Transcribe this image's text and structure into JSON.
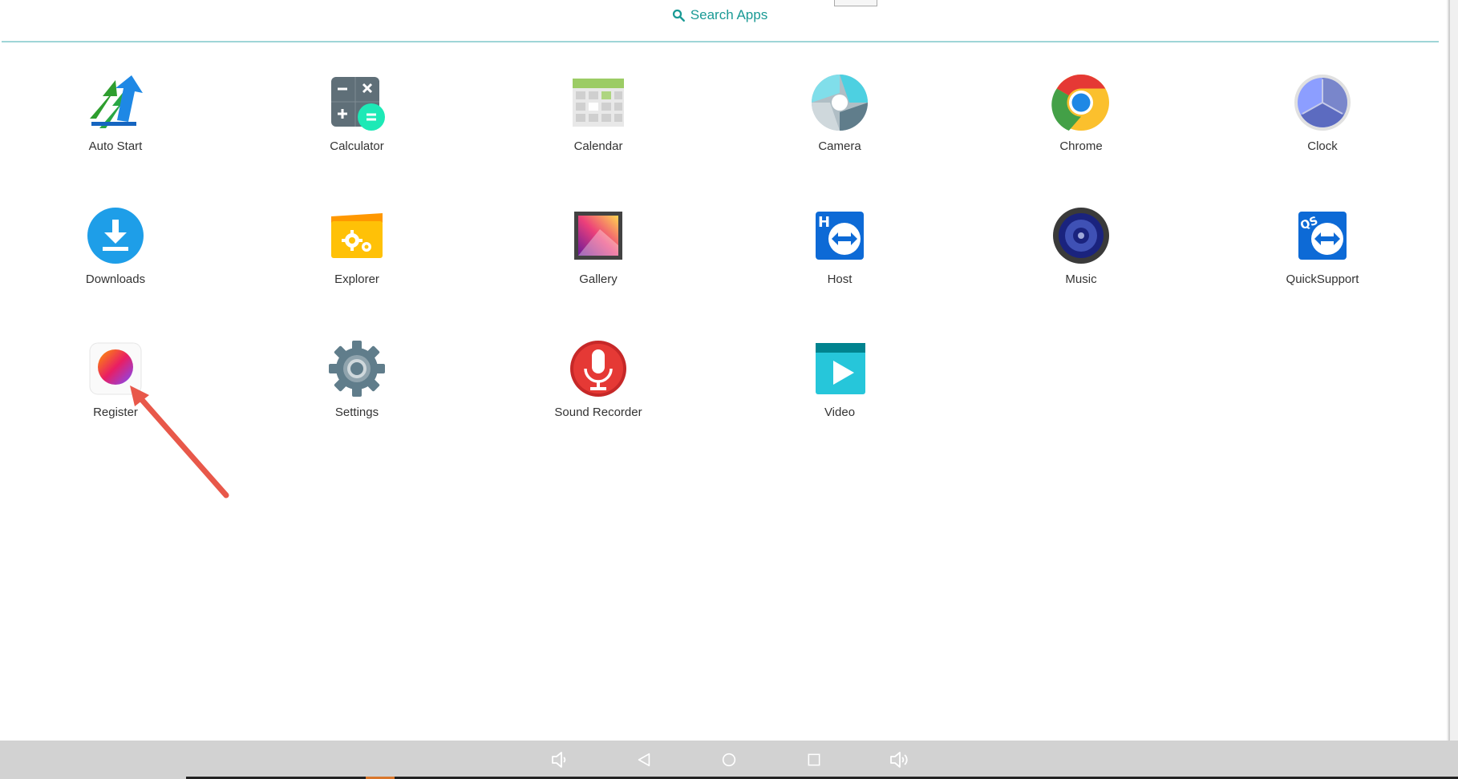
{
  "search": {
    "label": "Search Apps"
  },
  "apps": [
    {
      "name": "auto-start",
      "label": "Auto Start",
      "icon": "auto-start-icon"
    },
    {
      "name": "calculator",
      "label": "Calculator",
      "icon": "calculator-icon"
    },
    {
      "name": "calendar",
      "label": "Calendar",
      "icon": "calendar-icon"
    },
    {
      "name": "camera",
      "label": "Camera",
      "icon": "camera-icon"
    },
    {
      "name": "chrome",
      "label": "Chrome",
      "icon": "chrome-icon"
    },
    {
      "name": "clock",
      "label": "Clock",
      "icon": "clock-icon"
    },
    {
      "name": "downloads",
      "label": "Downloads",
      "icon": "download-icon"
    },
    {
      "name": "explorer",
      "label": "Explorer",
      "icon": "folder-gear-icon"
    },
    {
      "name": "gallery",
      "label": "Gallery",
      "icon": "gallery-icon"
    },
    {
      "name": "host",
      "label": "Host",
      "icon": "teamviewer-host-icon"
    },
    {
      "name": "music",
      "label": "Music",
      "icon": "speaker-icon"
    },
    {
      "name": "quicksupport",
      "label": "QuickSupport",
      "icon": "teamviewer-quicksupport-icon"
    },
    {
      "name": "register",
      "label": "Register",
      "icon": "gradient-orb-icon"
    },
    {
      "name": "settings",
      "label": "Settings",
      "icon": "gear-icon"
    },
    {
      "name": "sound-recorder",
      "label": "Sound Recorder",
      "icon": "microphone-icon"
    },
    {
      "name": "video",
      "label": "Video",
      "icon": "play-icon"
    }
  ],
  "nav": {
    "buttons": [
      "volume-down-icon",
      "back-icon",
      "home-icon",
      "recents-icon",
      "volume-up-icon"
    ]
  },
  "colors": {
    "accent": "#1a9a95",
    "annotation": "#e8584a",
    "nav_bar": "#d2d2d2"
  }
}
